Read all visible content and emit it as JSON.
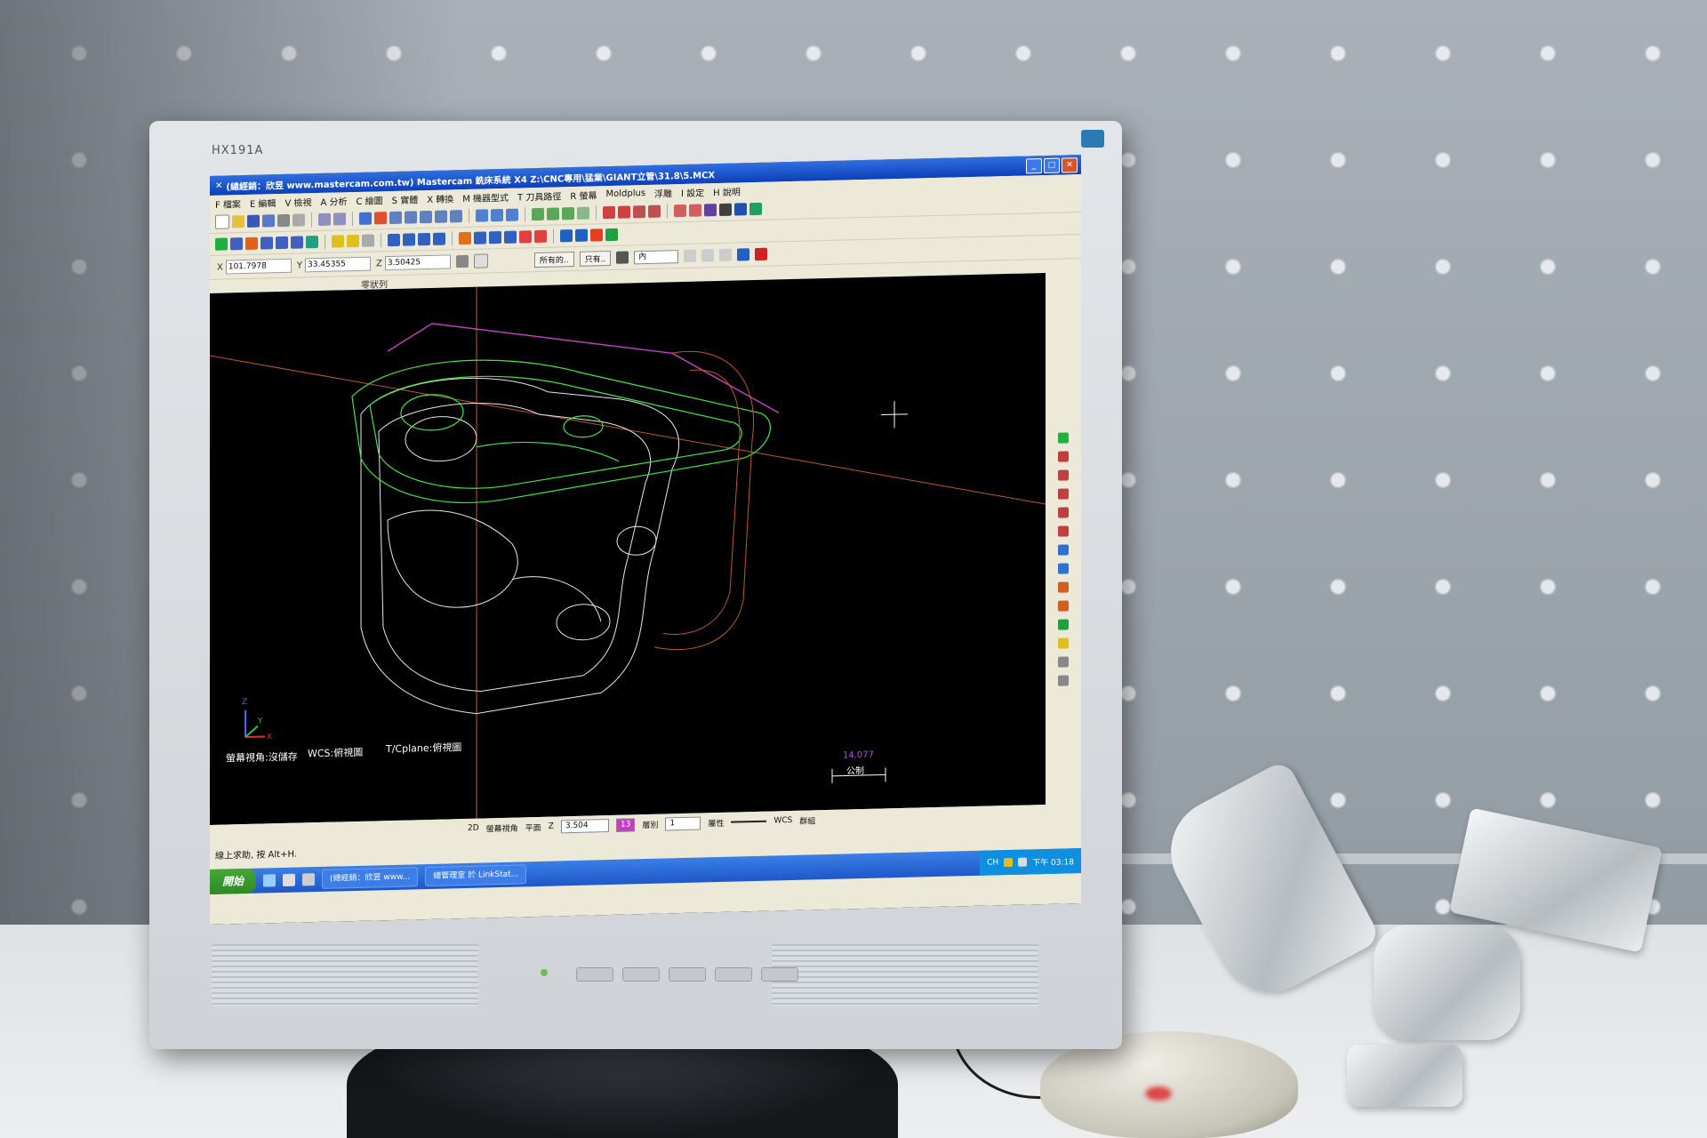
{
  "monitor": {
    "model": "HX191A"
  },
  "window": {
    "title": "(總經銷：欣昱 www.mastercam.com.tw) Mastercam 銑床系統 X4  Z:\\CNC專用\\猛業\\GIANT立管\\31.8\\5.MCX",
    "buttons": {
      "minimize": "_",
      "maximize": "□",
      "close": "×"
    }
  },
  "menu": [
    "F 檔案",
    "E 編輯",
    "V 檢視",
    "A 分析",
    "C 繪圖",
    "S 實體",
    "X 轉換",
    "M 機器型式",
    "T 刀具路徑",
    "R 螢幕",
    "Moldplus",
    "浮雕",
    "I 設定",
    "H 說明"
  ],
  "coords": {
    "x_label": "X",
    "x": "101.7978",
    "y_label": "Y",
    "y": "33.45355",
    "z_label": "Z",
    "z": "3.50425"
  },
  "selection": {
    "all_label": "所有的..",
    "only_label": "只有..",
    "mode": "內"
  },
  "panel_label": "零狀列",
  "viewport": {
    "scale_value": "14.077",
    "scale_unit": "公制",
    "axis_z": "Z",
    "axis_y": "Y",
    "axis_x": "X",
    "info_view": "螢幕視角:沒儲存",
    "info_wcs": "WCS:俯視圖",
    "info_tplane": "T/Cplane:俯視圖"
  },
  "statusbar": {
    "mode_2d": "2D",
    "screen_view": "螢幕視角",
    "plane": "平面",
    "z_label": "Z",
    "z_value": "3.504",
    "color_value": "13",
    "level_label": "層別",
    "level_value": "1",
    "attr_label": "屬性",
    "wcs_label": "WCS",
    "group_label": "群組"
  },
  "hint": "線上求助, 按 Alt+H.",
  "taskbar": {
    "start_label": "開始",
    "tasks": [
      "(總經銷：欣昱 www...",
      "總管理室 於 LinkStat..."
    ],
    "tray_lang": "CH",
    "time": "下午 03:18"
  },
  "colors": {
    "title_blue": "#0d3fb8",
    "wire_green": "#3ee83e",
    "wire_white": "#e8e8e8",
    "wire_orange": "#c0582a",
    "wire_magenta": "#c040c0"
  }
}
